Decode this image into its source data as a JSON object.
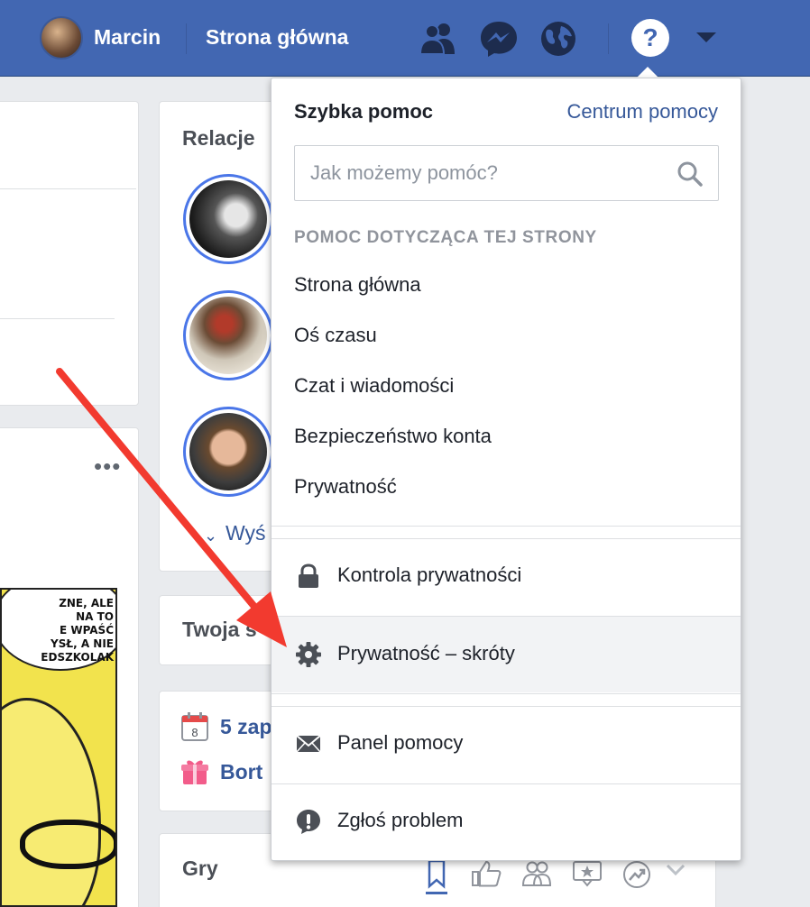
{
  "topbar": {
    "user_name": "Marcin",
    "home_label": "Strona główna",
    "icons": [
      "friends-icon",
      "messenger-icon",
      "globe-icon",
      "help-icon",
      "account-caret-icon"
    ],
    "help_glyph": "?",
    "bar_color": "#4267b2"
  },
  "sidebar": {
    "stories_title": "Relacje",
    "see_more": "Wyś",
    "your_page_title": "Twoja s",
    "events_count": "5 zap",
    "events_calendar_day": "8",
    "birthdays": "Bort",
    "games_title": "Gry"
  },
  "feed": {
    "post_menu": "•••",
    "comic_text": "ZNE, ALE\n NA TO\nE WPAŚĆ\nYSŁ, A NIE\nEDSZKOLAK"
  },
  "dropdown": {
    "title": "Szybka pomoc",
    "help_center_link": "Centrum pomocy",
    "search_placeholder": "Jak możemy pomóc?",
    "section_header": "POMOC DOTYCZĄCA TEJ STRONY",
    "topics": [
      "Strona główna",
      "Oś czasu",
      "Czat i wiadomości",
      "Bezpieczeństwo konta",
      "Prywatność"
    ],
    "actions": [
      {
        "label": "Kontrola prywatności",
        "icon": "lock-icon"
      },
      {
        "label": "Prywatność – skróty",
        "icon": "gear-icon"
      },
      {
        "label": "Panel pomocy",
        "icon": "envelope-icon"
      },
      {
        "label": "Zgłoś problem",
        "icon": "exclamation-icon"
      }
    ]
  },
  "colors": {
    "accent": "#4267b2",
    "link": "#365899",
    "annotation_arrow": "#f23a2f"
  }
}
